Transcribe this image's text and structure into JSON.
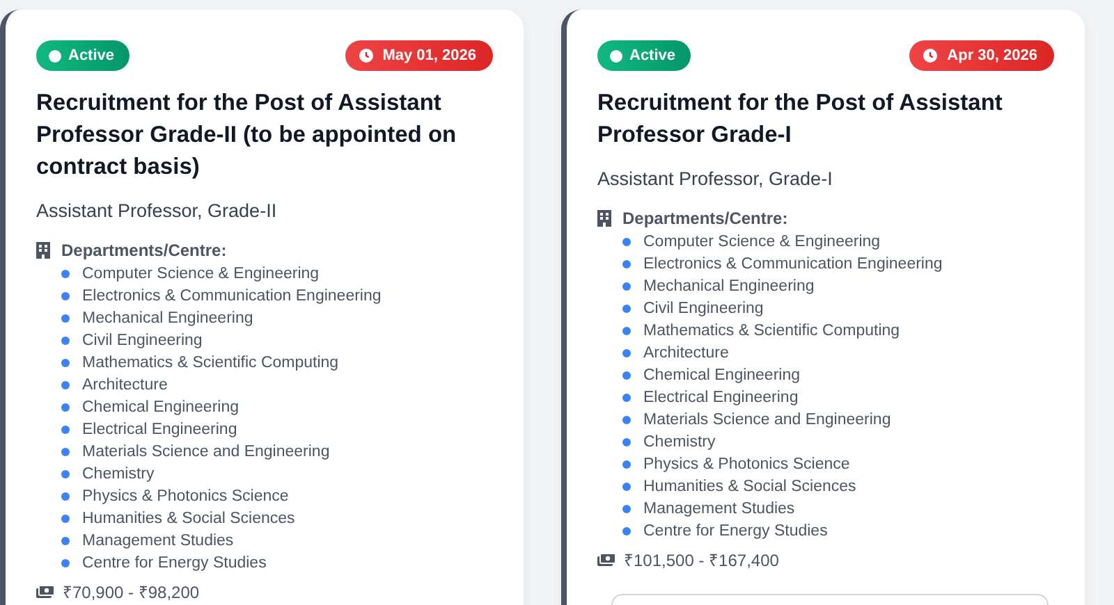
{
  "cards": [
    {
      "status": {
        "label": "Active",
        "kind": "active"
      },
      "deadline": "May 01, 2026",
      "title": "Recruitment for the Post of Assistant Professor Grade-II (to be appointed on contract basis)",
      "position": "Assistant Professor, Grade-II",
      "departments_label": "Departments/Centre:",
      "departments": [
        "Computer Science & Engineering",
        "Electronics & Communication Engineering",
        "Mechanical Engineering",
        "Civil Engineering",
        "Mathematics & Scientific Computing",
        "Architecture",
        "Chemical Engineering",
        "Electrical Engineering",
        "Materials Science and Engineering",
        "Chemistry",
        "Physics & Photonics Science",
        "Humanities & Social Sciences",
        "Management Studies",
        "Centre for Energy Studies"
      ],
      "salary": "₹70,900 - ₹98,200"
    },
    {
      "status": {
        "label": "Active",
        "kind": "active"
      },
      "deadline": "Apr 30, 2026",
      "title": "Recruitment for the Post of Assistant Professor Grade-I",
      "position": "Assistant Professor, Grade-I",
      "departments_label": "Departments/Centre:",
      "departments": [
        "Computer Science & Engineering",
        "Electronics & Communication Engineering",
        "Mechanical Engineering",
        "Civil Engineering",
        "Mathematics & Scientific Computing",
        "Architecture",
        "Chemical Engineering",
        "Electrical Engineering",
        "Materials Science and Engineering",
        "Chemistry",
        "Physics & Photonics Science",
        "Humanities & Social Sciences",
        "Management Studies",
        "Centre for Energy Studies"
      ],
      "salary": "₹101,500 - ₹167,400"
    }
  ]
}
